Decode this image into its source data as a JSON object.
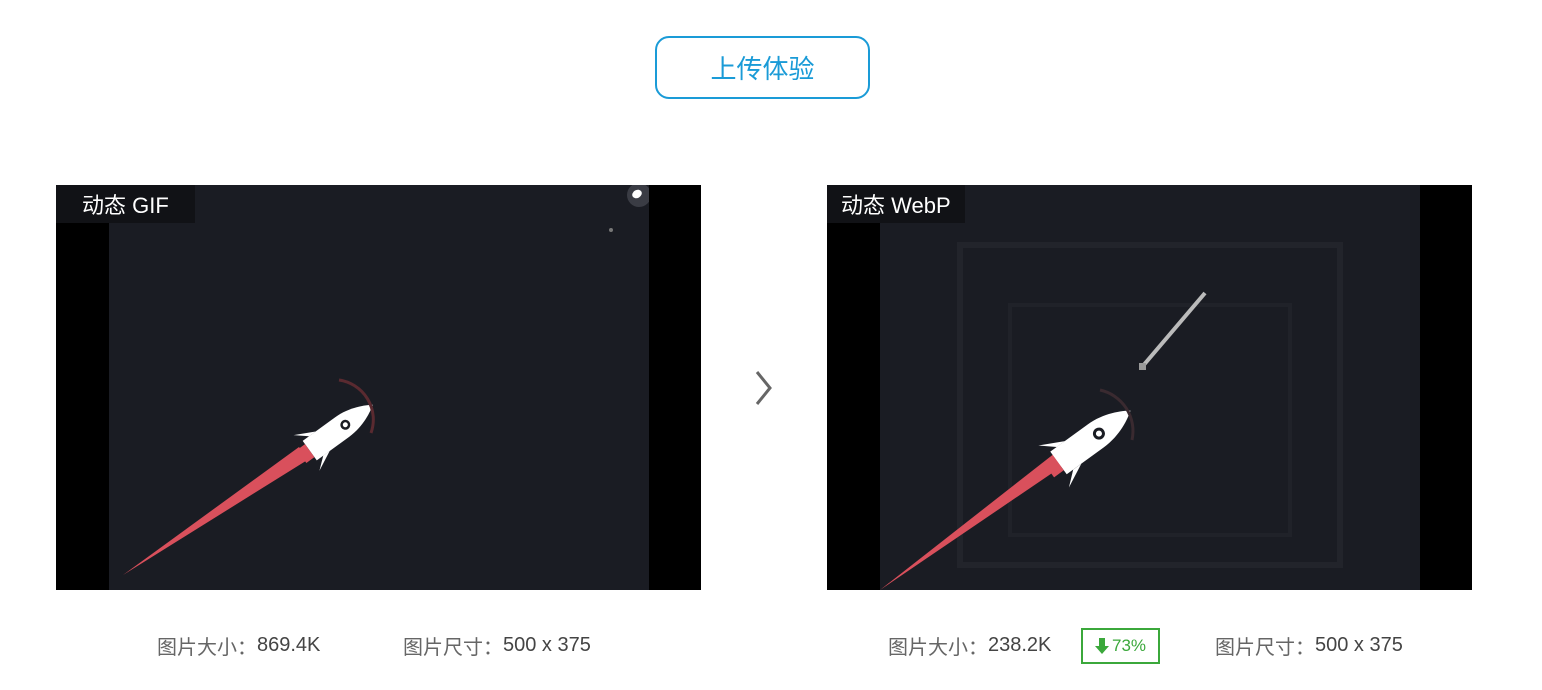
{
  "upload_button": {
    "label": "上传体验"
  },
  "left_panel": {
    "label": "动态 GIF",
    "size_key": "图片大小：",
    "size_value": "869.4K",
    "dim_key": "图片尺寸：",
    "dim_value": "500 x 375"
  },
  "right_panel": {
    "label": "动态 WebP",
    "size_key": "图片大小：",
    "size_value": "238.2K",
    "reduction": "73%",
    "dim_key": "图片尺寸：",
    "dim_value": "500 x 375"
  },
  "icons": {
    "next": "chevron-right-icon",
    "down": "arrow-down-icon",
    "rocket": "rocket-icon"
  },
  "colors": {
    "accent": "#1a9bd7",
    "badge_green": "#3ba83b",
    "canvas_bg": "#1a1c23",
    "flame": "#d9505c"
  }
}
